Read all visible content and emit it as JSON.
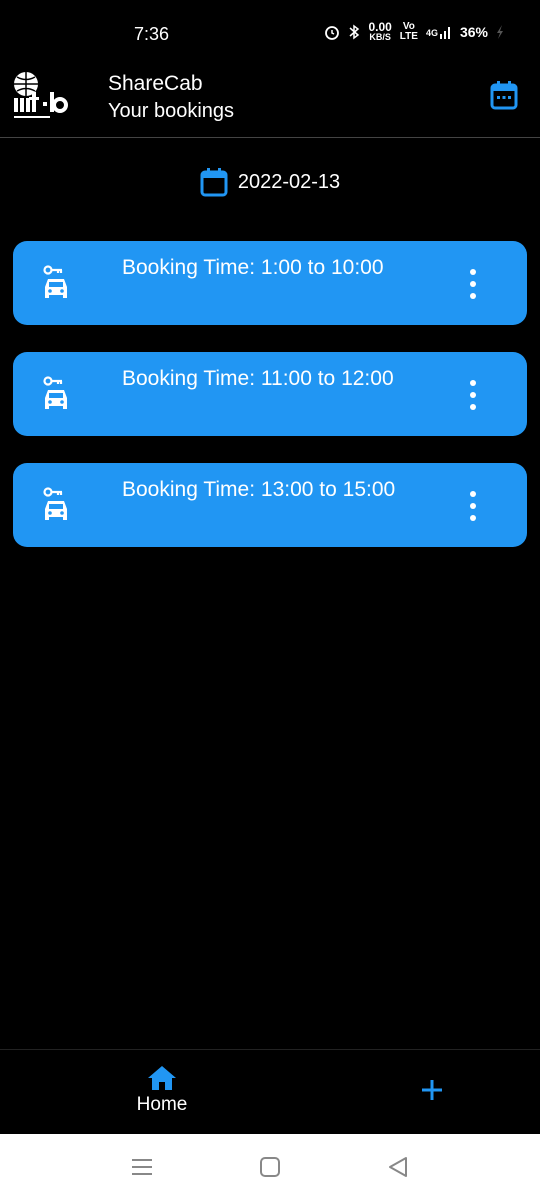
{
  "status_bar": {
    "time": "7:36",
    "net_speed_top": "0.00",
    "net_speed_bottom": "KB/S",
    "volte_top": "Vo",
    "volte_bottom": "LTE",
    "network": "4G",
    "battery": "36%"
  },
  "app_bar": {
    "logo_text": "iiit·b",
    "title": "ShareCab",
    "subtitle": "Your bookings",
    "calendar_icon": "calendar-today-icon"
  },
  "date_selector": {
    "date": "2022-02-13",
    "icon": "calendar-icon"
  },
  "bookings": [
    {
      "text": "Booking Time: 1:00 to 10:00",
      "icon": "car-key-icon",
      "menu_icon": "more-vert-icon"
    },
    {
      "text": "Booking Time: 11:00 to 12:00",
      "icon": "car-key-icon",
      "menu_icon": "more-vert-icon"
    },
    {
      "text": "Booking Time: 13:00 to 15:00",
      "icon": "car-key-icon",
      "menu_icon": "more-vert-icon"
    }
  ],
  "bottom_nav": {
    "home_label": "Home",
    "home_icon": "home-icon",
    "add_icon": "add-icon"
  },
  "system_nav": {
    "buttons": [
      "menu-icon",
      "home-square-icon",
      "back-icon"
    ]
  },
  "colors": {
    "accent": "#2196f3",
    "background": "#000000",
    "card_text": "#ffffff"
  }
}
